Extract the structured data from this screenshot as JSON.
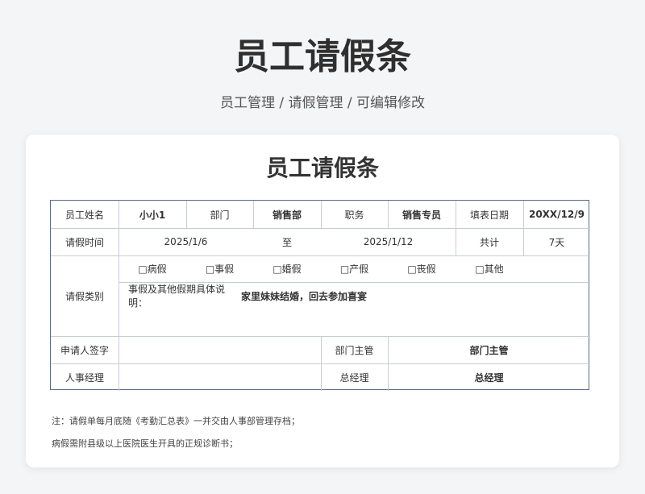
{
  "page": {
    "title": "员工请假条",
    "breadcrumb": "员工管理 / 请假管理 / 可编辑修改"
  },
  "form": {
    "title": "员工请假条",
    "labels": {
      "name": "员工姓名",
      "dept": "部门",
      "pos": "职务",
      "fill": "填表日期",
      "period": "请假时间",
      "to": "至",
      "total": "共计",
      "type": "请假类别",
      "desc": "事假及其他假期具体说明：",
      "applicant": "申请人签字",
      "mgr": "部门主管",
      "hr": "人事经理",
      "gm": "总经理"
    },
    "values": {
      "name": "小小1",
      "dept": "销售部",
      "pos": "销售专员",
      "fill": "20XX/12/9",
      "start": "2025/1/6",
      "end": "2025/1/12",
      "days": "7天",
      "desc": "家里妹妹结婚，回去参加喜宴",
      "mgr": "部门主管",
      "gm": "总经理"
    },
    "types": [
      "□病假",
      "□事假",
      "□婚假",
      "□产假",
      "□丧假",
      "□其他"
    ],
    "notes": [
      "注：请假单每月底随《考勤汇总表》一并交由人事部管理存档；",
      "病假需附县级以上医院医生开具的正规诊断书；"
    ]
  }
}
